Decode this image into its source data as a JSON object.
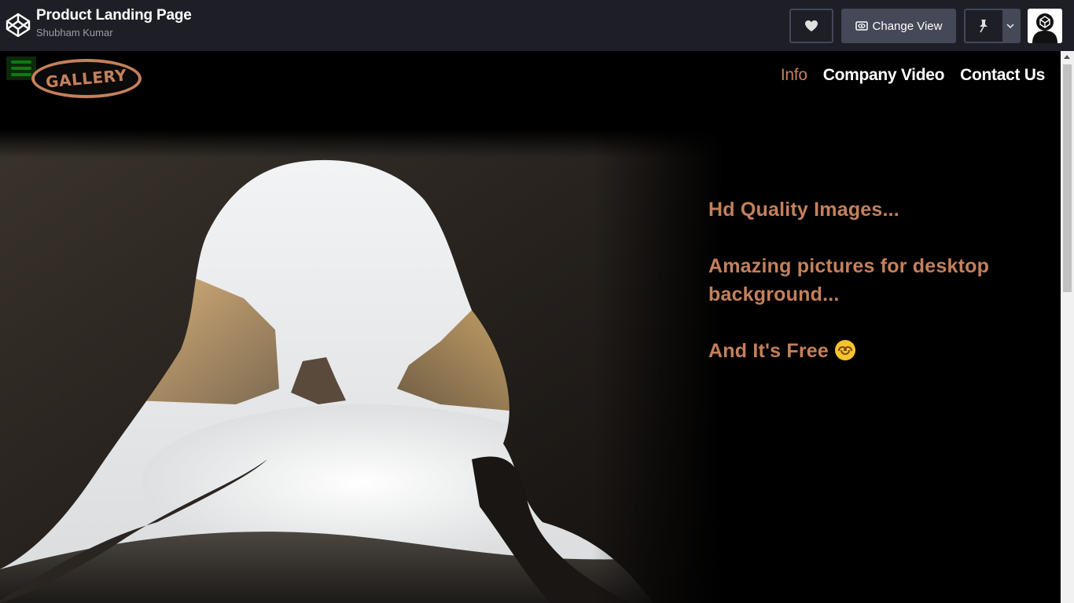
{
  "codepen": {
    "title": "Product Landing Page",
    "author": "Shubham Kumar",
    "change_view_label": "Change View"
  },
  "site": {
    "logo_text": "GALLERY",
    "nav": [
      {
        "label": "Info",
        "active": true
      },
      {
        "label": "Company Video",
        "active": false
      },
      {
        "label": "Contact Us",
        "active": false
      }
    ],
    "taglines": [
      "Hd Quality Images...",
      "Amazing pictures for desktop background...",
      "And It's Free"
    ]
  },
  "colors": {
    "topbar_bg": "#1e1f26",
    "button_bg": "#444857",
    "accent": "#c5805b",
    "hamburger": "#0e7a14"
  },
  "icons": {
    "codepen_logo": "codepen-logo-icon",
    "heart": "heart-icon",
    "change_view": "eye-icon",
    "pin": "pin-icon",
    "caret": "chevron-down-icon",
    "menu": "hamburger-menu-icon",
    "emoji": "smiling-face-emoji-icon"
  }
}
